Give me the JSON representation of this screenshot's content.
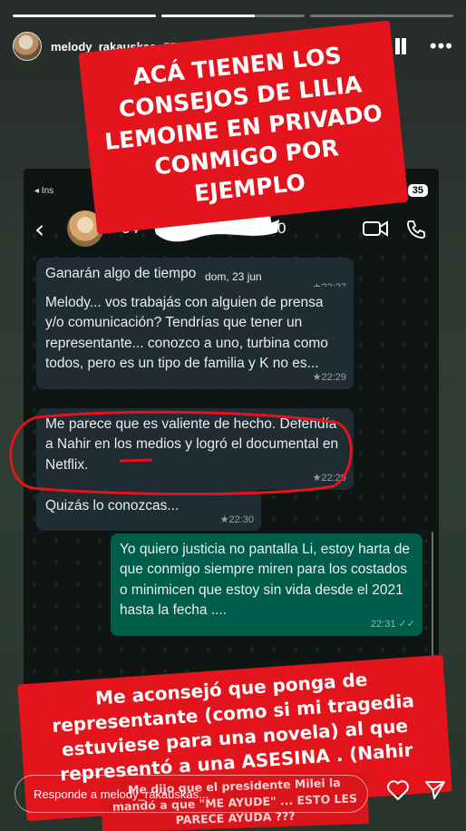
{
  "story": {
    "progress_fill": [
      1.0,
      0.65,
      0.0
    ],
    "username": "melody_rakauskas",
    "time": "57 min",
    "icons": [
      "pause-icon",
      "more-icon",
      "heart-icon",
      "send-icon"
    ]
  },
  "captions": {
    "top": "ACÁ TIENEN LOS CONSEJOS DE LILIA LEMOINE EN PRIVADO CONMIGO POR EJEMPLO",
    "bottom": "Me aconsejó que ponga de representante (como si mi tragedia estuviese para una novela) al que representó a una ASESINA . (Nahir Galarza )",
    "small": "Me dijo que el presidente Milei la mandó a que \"ME AYUDE\" ... ESTO LES PARECE AYUDA ???"
  },
  "whatsapp": {
    "status_back": "◂ Ins",
    "battery": "35",
    "contact": "+54",
    "contact_tail": "7540",
    "date_pill": "dom, 23 jun",
    "messages": [
      {
        "text": "Ganarán algo de tiempo",
        "time": "★22:27"
      },
      {
        "text": "Melody... vos trabajás con alguien de prensa y/o comunicación? Tendrías que tener un representante... conozco a uno, turbina como todos, pero es un tipo de familia y K no es...",
        "time": "★22:29"
      },
      {
        "text": "Me parece que es valiente de hecho. Defendía a Nahir en los medios y logró el documental en Netflix.",
        "time": "★22:29"
      },
      {
        "text": "Quizás lo conozcas...",
        "time": "★22:30"
      },
      {
        "text": "Yo quiero justicia no pantalla Li, estoy harta de que conmigo siempre miren para los costados o minimicen que estoy sin vida desde el 2021 hasta la fecha ....",
        "time": "22:31 ✓✓"
      }
    ]
  },
  "footer": {
    "reply_placeholder": "Responde a melody_rakauskas..."
  },
  "colors": {
    "caption_red": "#e3141b",
    "incoming_bubble": "#1f2c33",
    "outgoing_bubble": "#005c4b"
  }
}
